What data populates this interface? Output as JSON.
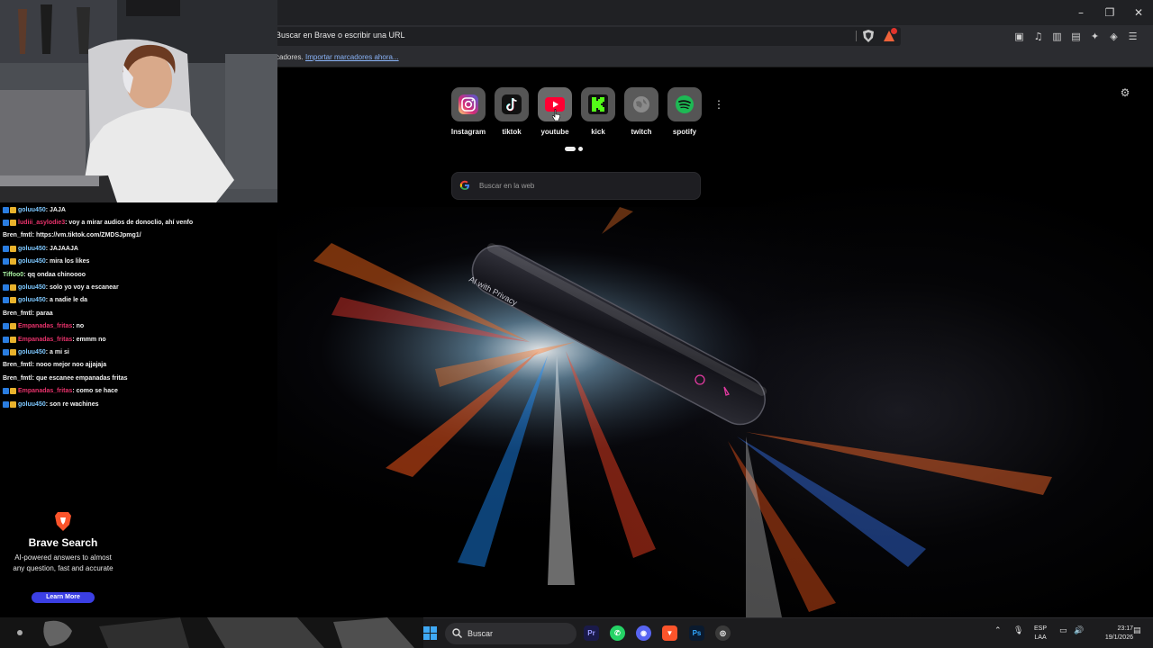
{
  "browser": {
    "url_placeholder": "Buscar en Brave o escribir una URL",
    "bookmarks_prompt": "cadores.",
    "import_link": "Importar marcadores ahora..."
  },
  "window_controls": {
    "minimize": "–",
    "maximize": "❐",
    "close": "✕"
  },
  "ntp": {
    "top_sites": [
      {
        "label": "Instagram",
        "icon": "instagram-icon",
        "color": "#d6249f"
      },
      {
        "label": "tiktok",
        "icon": "tiktok-icon",
        "color": "#111111"
      },
      {
        "label": "youtube",
        "icon": "youtube-icon",
        "color": "#ff0033"
      },
      {
        "label": "kick",
        "icon": "kick-icon",
        "color": "#53fc18"
      },
      {
        "label": "twitch",
        "icon": "globe-icon",
        "color": "#7a7a7a"
      },
      {
        "label": "spotify",
        "icon": "spotify-icon",
        "color": "#1db954"
      }
    ],
    "search_placeholder": "Buscar en la web",
    "hero_text": "AI with Privacy"
  },
  "chat": {
    "messages": [
      {
        "user": "goluu450",
        "msg": " : JAJA",
        "color": "#7ec8ff",
        "badges": true
      },
      {
        "user": "ludiii_asylodie3",
        "msg": " : voy a mirar audios de donoclio, ahí venfo",
        "color": "#e8326b",
        "badges": true
      },
      {
        "user": "Bren_fmtl",
        "msg": " : https://vm.tiktok.com/ZMDSJpmg1/",
        "color": "#f2f2f2",
        "badges": false
      },
      {
        "user": "goluu450",
        "msg": " : JAJAAJA",
        "color": "#7ec8ff",
        "badges": true
      },
      {
        "user": "goluu450",
        "msg": " : mira los likes",
        "color": "#7ec8ff",
        "badges": true
      },
      {
        "user": "Tiffoo0",
        "msg": " : qq ondaa chinoooo",
        "color": "#a8f0a0",
        "badges": false
      },
      {
        "user": "goluu450",
        "msg": " : solo yo voy a escanear",
        "color": "#7ec8ff",
        "badges": true
      },
      {
        "user": "goluu450",
        "msg": " : a nadie le da",
        "color": "#7ec8ff",
        "badges": true
      },
      {
        "user": "Bren_fmtl",
        "msg": " : paraa",
        "color": "#f2f2f2",
        "badges": false
      },
      {
        "user": "Empanadas_fritas",
        "msg": " : no",
        "color": "#e8326b",
        "badges": true
      },
      {
        "user": "Empanadas_fritas",
        "msg": " : emmm no",
        "color": "#e8326b",
        "badges": true
      },
      {
        "user": "goluu450",
        "msg": " : a mi si",
        "color": "#7ec8ff",
        "badges": true
      },
      {
        "user": "Bren_fmtl",
        "msg": " : nooo mejor noo ajjajaja",
        "color": "#f2f2f2",
        "badges": false
      },
      {
        "user": "Bren_fmtl",
        "msg": " : que escanee empanadas fritas",
        "color": "#f2f2f2",
        "badges": false
      },
      {
        "user": "Empanadas_fritas",
        "msg": " : como se hace",
        "color": "#e8326b",
        "badges": true
      },
      {
        "user": "goluu450",
        "msg": " : son re wachines",
        "color": "#7ec8ff",
        "badges": true
      }
    ]
  },
  "brave_ad": {
    "title": "Brave Search",
    "text": "AI-powered answers to almost any question, fast and accurate",
    "button": "Learn More"
  },
  "taskbar": {
    "search_label": "Buscar",
    "lang_top": "ESP",
    "lang_bottom": "LAA",
    "time": "23:17",
    "date": "19/1/2026"
  }
}
